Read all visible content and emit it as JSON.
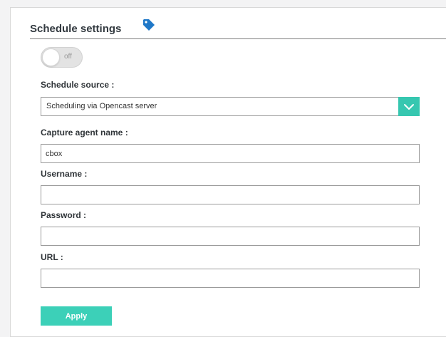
{
  "header": {
    "title": "Schedule settings",
    "icon": "tag-icon"
  },
  "toggle": {
    "state_label": "off",
    "enabled": false
  },
  "schedule_source": {
    "label": "Schedule source :",
    "selected": "Scheduling via Opencast server",
    "icon": "chevron-down-icon"
  },
  "capture_agent": {
    "label": "Capture agent name :",
    "value": "cbox"
  },
  "username": {
    "label": "Username :",
    "value": ""
  },
  "password": {
    "label": "Password :",
    "value": ""
  },
  "url": {
    "label": "URL :",
    "value": ""
  },
  "apply_button": {
    "label": "Apply"
  },
  "colors": {
    "accent": "#3cd0b8",
    "icon_blue": "#1f78c8",
    "text": "#2f3438"
  }
}
